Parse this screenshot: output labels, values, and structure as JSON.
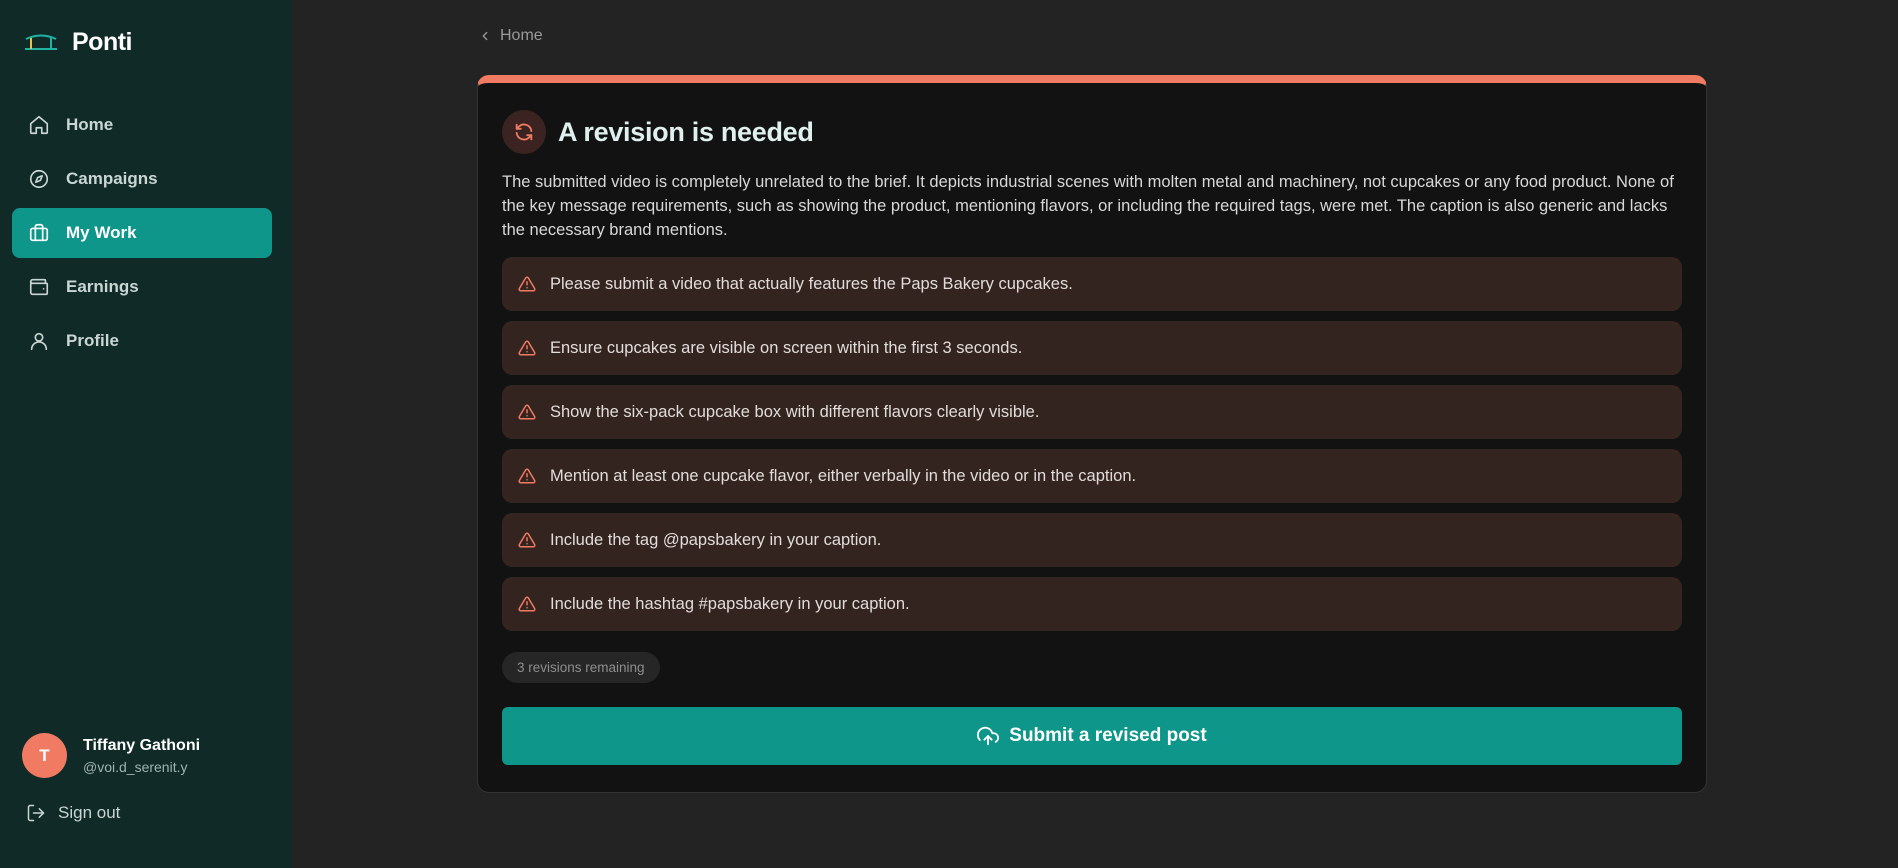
{
  "brand": {
    "name": "Ponti",
    "icon": "bridge-logo-icon"
  },
  "nav": {
    "items": [
      {
        "label": "Home",
        "icon": "home-icon",
        "active": false
      },
      {
        "label": "Campaigns",
        "icon": "compass-icon",
        "active": false
      },
      {
        "label": "My Work",
        "icon": "briefcase-icon",
        "active": true
      },
      {
        "label": "Earnings",
        "icon": "wallet-icon",
        "active": false
      },
      {
        "label": "Profile",
        "icon": "user-icon",
        "active": false
      }
    ]
  },
  "user": {
    "initial": "T",
    "name": "Tiffany Gathoni",
    "handle": "@voi.d_serenit.y"
  },
  "signout": {
    "label": "Sign out",
    "icon": "log-out-icon"
  },
  "breadcrumb": {
    "label": "Home",
    "icon": "chevron-left-icon"
  },
  "card": {
    "title": "A revision is needed",
    "icon": "refresh-icon",
    "summary": "The submitted video is completely unrelated to the brief. It depicts industrial scenes with molten metal and machinery, not cupcakes or any food product. None of the key message requirements, such as showing the product, mentioning flavors, or including the required tags, were met. The caption is also generic and lacks the necessary brand mentions.",
    "issues": [
      "Please submit a video that actually features the Paps Bakery cupcakes.",
      "Ensure cupcakes are visible on screen within the first 3 seconds.",
      "Show the six-pack cupcake box with different flavors clearly visible.",
      "Mention at least one cupcake flavor, either verbally in the video or in the caption.",
      "Include the tag @papsbakery in your caption.",
      "Include the hashtag #papsbakery in your caption."
    ],
    "issue_icon": "warning-triangle-icon",
    "revisions_remaining": "3 revisions remaining",
    "submit_label": "Submit a revised post",
    "submit_icon": "upload-cloud-icon"
  },
  "colors": {
    "sidebar_bg": "#0f2a27",
    "accent": "#0e968a",
    "warning": "#f07a62",
    "issue_bg": "#33241f",
    "main_bg": "#232323",
    "card_bg": "#121212"
  }
}
